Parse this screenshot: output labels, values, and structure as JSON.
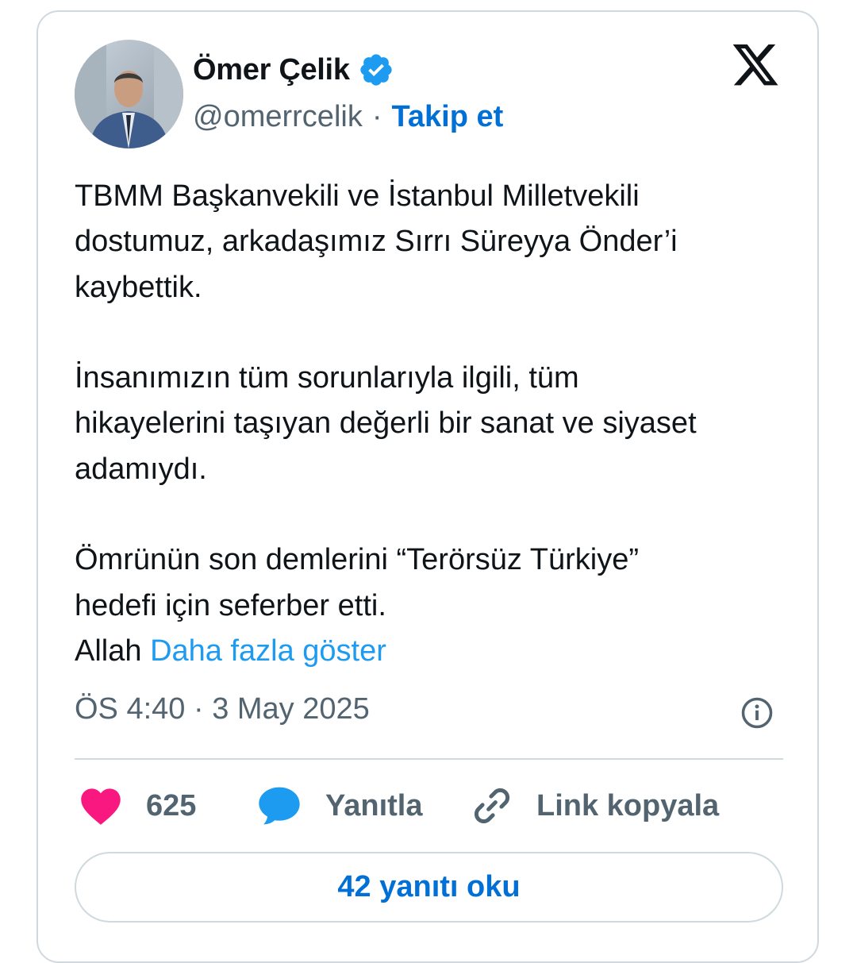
{
  "author": {
    "name": "Ömer Çelik",
    "handle": "@omerrcelik",
    "separator": "·",
    "follow_label": "Takip et",
    "verified": true
  },
  "icons": {
    "verified": "verified-badge-icon",
    "brand": "x-logo-icon",
    "info": "info-icon",
    "like": "heart-icon",
    "reply": "speech-bubble-icon",
    "copy": "link-icon"
  },
  "tweet": {
    "lines_p1": [
      "TBMM Başkanvekili ve İstanbul Milletvekili",
      "dostumuz, arkadaşımız Sırrı Süreyya Önder’i",
      "kaybettik."
    ],
    "lines_p2": [
      "İnsanımızın tüm sorunlarıyla ilgili, tüm",
      "hikayelerini taşıyan değerli bir sanat ve siyaset",
      "adamıydı."
    ],
    "lines_p3": [
      "Ömrünün son demlerini “Terörsüz Türkiye”",
      "hedefi için seferber etti."
    ],
    "last_line_prefix": "Allah",
    "show_more": "Daha fazla göster",
    "timestamp": "ÖS 4:40 · 3 May 2025"
  },
  "actions": {
    "like_count": "625",
    "reply_label": "Yanıtla",
    "copy_label": "Link kopyala"
  },
  "read_replies_label": "42 yanıtı oku",
  "colors": {
    "text": "#0f1419",
    "secondary": "#536471",
    "link": "#1d9bf0",
    "follow": "#006fd6",
    "like": "#f91880",
    "reply": "#1d9bf0",
    "verified": "#1d9bf0",
    "border": "#cfd9de"
  }
}
